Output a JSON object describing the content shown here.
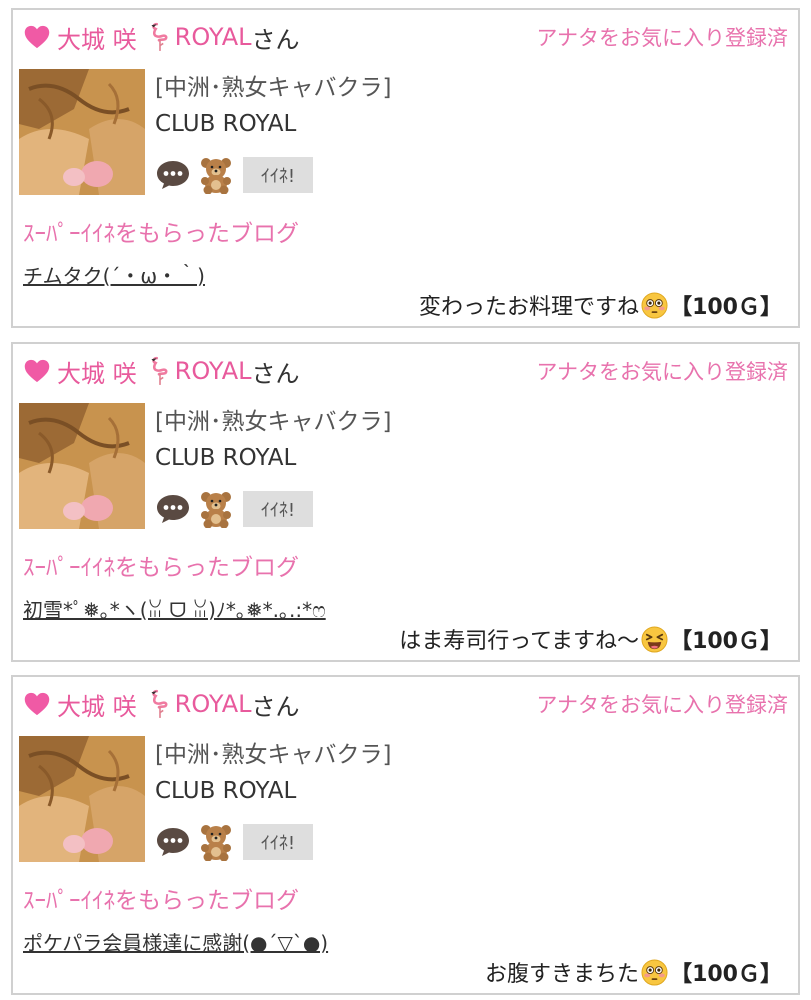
{
  "posts": [
    {
      "cast_name": "大城 咲",
      "shop_short": "ROYAL",
      "honorific": "さん",
      "fav_status": "アナタをお気に入り登録済",
      "shop_area": "[中洲･熟女キャバクラ]",
      "shop_name": "CLUB ROYAL",
      "like_label": "ｲｲﾈ!",
      "super_label": "ｽｰﾊﾟｰｲｲﾈをもらったブログ",
      "blog_title": "チムタク(´・ω・｀)",
      "comment": "変わったお料理ですね",
      "emoji": "flushed-face-icon",
      "points": "【100Ｇ】"
    },
    {
      "cast_name": "大城 咲",
      "shop_short": "ROYAL",
      "honorific": "さん",
      "fav_status": "アナタをお気に入り登録済",
      "shop_area": "[中洲･熟女キャバクラ]",
      "shop_name": "CLUB ROYAL",
      "like_label": "ｲｲﾈ!",
      "super_label": "ｽｰﾊﾟｰｲｲﾈをもらったブログ",
      "blog_title": "初雪*ﾟ❅｡*ヽ(ꈍ ᗜ ꈍ)ﾉ*｡❅*.｡.:*ෆ",
      "comment": "はま寿司行ってますね〜",
      "emoji": "laughing-face-icon",
      "points": "【100Ｇ】"
    },
    {
      "cast_name": "大城 咲",
      "shop_short": "ROYAL",
      "honorific": "さん",
      "fav_status": "アナタをお気に入り登録済",
      "shop_area": "[中洲･熟女キャバクラ]",
      "shop_name": "CLUB ROYAL",
      "like_label": "ｲｲﾈ!",
      "super_label": "ｽｰﾊﾟｰｲｲﾈをもらったブログ",
      "blog_title": "ポケパラ会員様達に感謝(●´▽`●)",
      "comment": "お腹すきまちた",
      "emoji": "flushed-face-icon",
      "points": "【100Ｇ】"
    }
  ],
  "colors": {
    "accent_pink": "#e85a9c",
    "border": "#d0d0d0",
    "like_button_bg": "#dedede"
  }
}
